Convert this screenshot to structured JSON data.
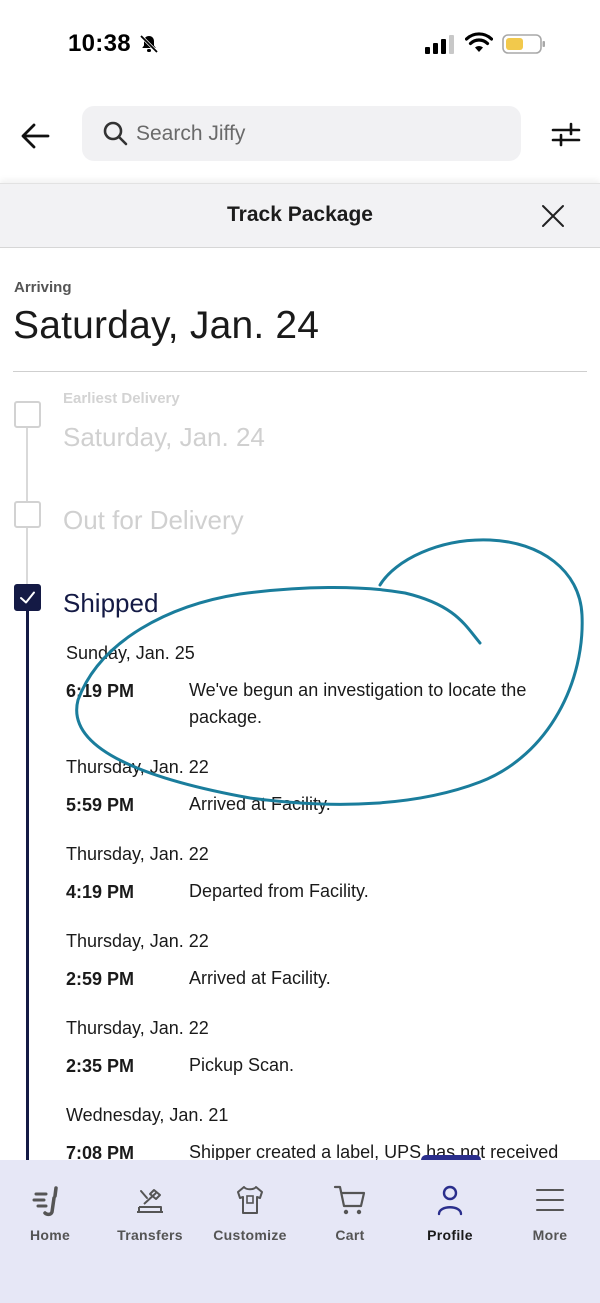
{
  "status_bar": {
    "time": "10:38"
  },
  "search": {
    "placeholder": "Search Jiffy"
  },
  "sheet": {
    "title": "Track Package"
  },
  "arriving": {
    "label": "Arriving",
    "date": "Saturday, Jan. 24"
  },
  "steps": [
    {
      "small": "Earliest Delivery",
      "title": "Saturday, Jan. 24",
      "checked": false
    },
    {
      "title": "Out for Delivery",
      "checked": false
    },
    {
      "title": "Shipped",
      "checked": true
    }
  ],
  "events": [
    {
      "date": "Sunday, Jan. 25",
      "time": "6:19 PM",
      "description": "We've begun an investigation to locate the package."
    },
    {
      "date": "Thursday, Jan. 22",
      "time": "5:59 PM",
      "description": "Arrived at Facility."
    },
    {
      "date": "Thursday, Jan. 22",
      "time": "4:19 PM",
      "description": "Departed from Facility."
    },
    {
      "date": "Thursday, Jan. 22",
      "time": "2:59 PM",
      "description": "Arrived at Facility."
    },
    {
      "date": "Thursday, Jan. 22",
      "time": "2:35 PM",
      "description": "Pickup Scan."
    },
    {
      "date": "Wednesday, Jan. 21",
      "time": "7:08 PM",
      "description": "Shipper created a label, UPS has not received"
    }
  ],
  "bottom_nav": [
    {
      "label": "Home",
      "icon": "home-icon"
    },
    {
      "label": "Transfers",
      "icon": "transfers-icon"
    },
    {
      "label": "Customize",
      "icon": "shirt-icon"
    },
    {
      "label": "Cart",
      "icon": "cart-icon"
    },
    {
      "label": "Profile",
      "icon": "profile-icon",
      "active": true
    },
    {
      "label": "More",
      "icon": "menu-icon"
    }
  ],
  "colors": {
    "accent": "#141a45",
    "nav_background": "#e6e7f6",
    "annotation": "#1a7d9c",
    "battery": "#f2c94c"
  }
}
